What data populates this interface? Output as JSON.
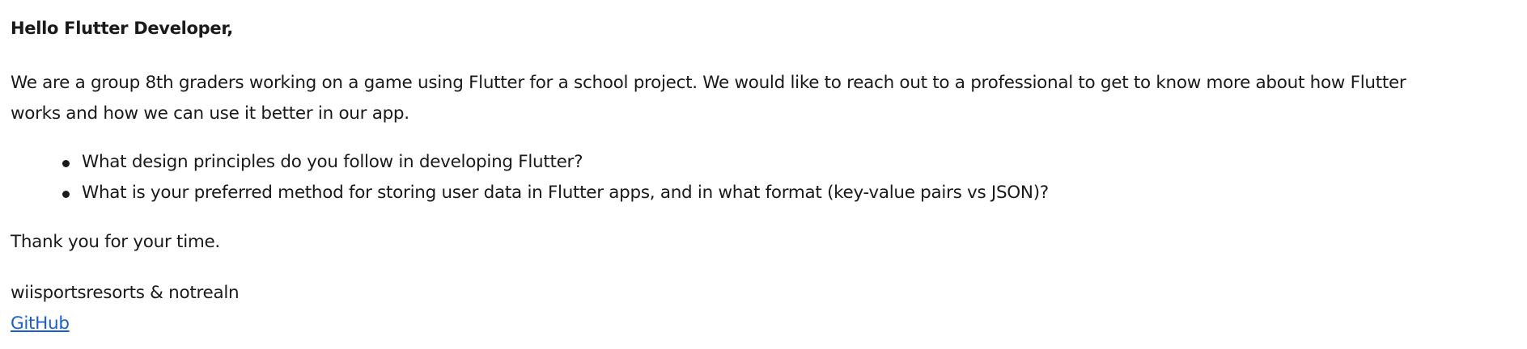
{
  "greeting": "Hello Flutter Developer,",
  "intro": {
    "line1": "We are a group 8th graders working on a game using Flutter for a school project. We would like to reach out to a professional to get to know more about how Flutter",
    "line2": "works and how we can use it better in our app."
  },
  "questions": [
    "What design principles do you follow in developing Flutter?",
    "What is your preferred method for storing user data in Flutter apps, and in what format (key-value pairs vs JSON)?"
  ],
  "closing": "Thank you for your time.",
  "signature": {
    "names": "wiisportsresorts & notrealn",
    "link_label": "GitHub"
  },
  "colors": {
    "text": "#1a1a1a",
    "link": "#1a5fd1",
    "background": "#ffffff"
  }
}
